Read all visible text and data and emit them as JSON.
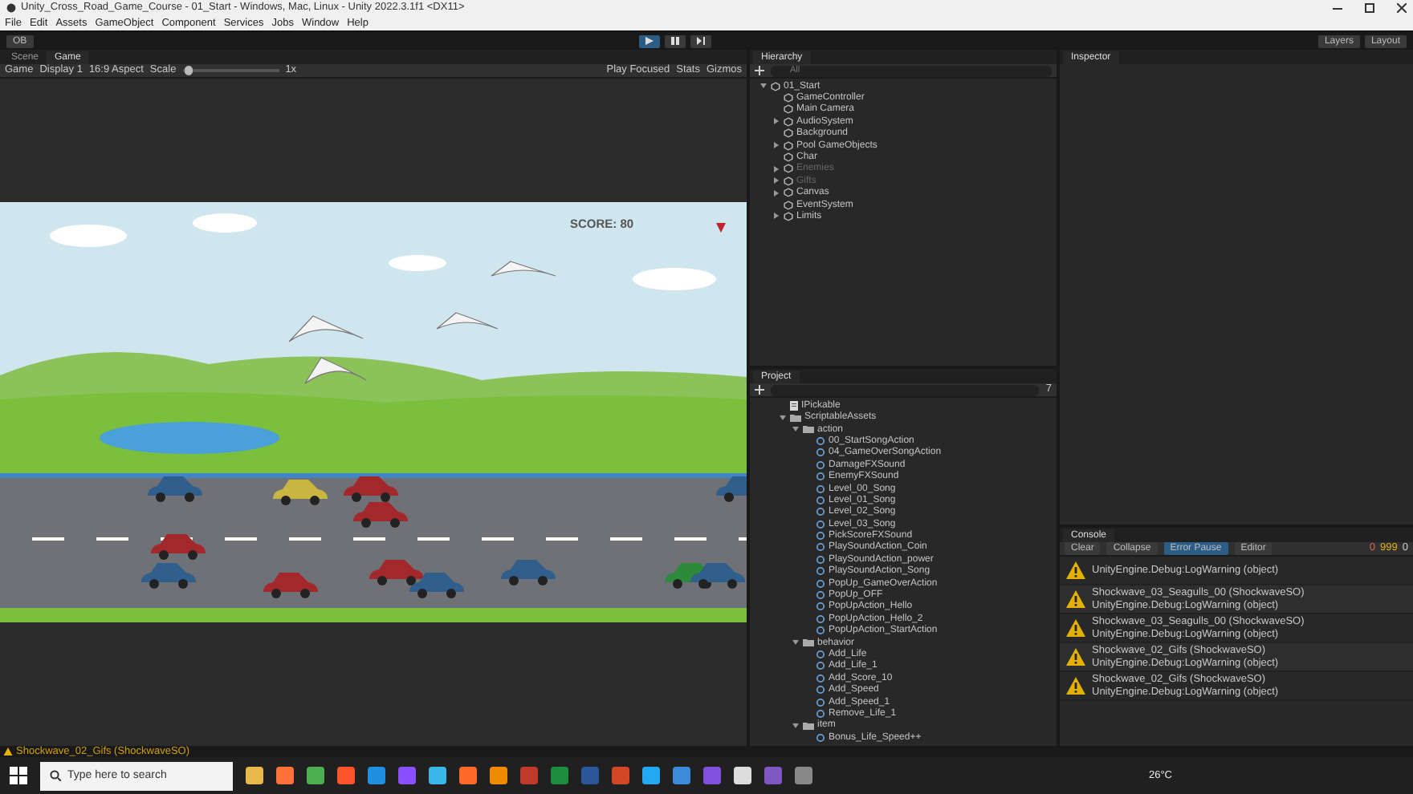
{
  "window": {
    "title": "Unity_Cross_Road_Game_Course - 01_Start - Windows, Mac, Linux - Unity 2022.3.1f1 <DX11>"
  },
  "menu": [
    "File",
    "Edit",
    "Assets",
    "GameObject",
    "Component",
    "Services",
    "Jobs",
    "Window",
    "Help"
  ],
  "toolbar": {
    "account": "OB",
    "playing": true,
    "paused": false,
    "layers": "Layers",
    "layout": "Layout"
  },
  "view_tabs": [
    {
      "label": "Scene",
      "selected": false
    },
    {
      "label": "Game",
      "selected": true
    }
  ],
  "game_toolbar": {
    "mode": "Game",
    "display": "Display 1",
    "aspect": "16:9 Aspect",
    "scale_label": "Scale",
    "scale_slider": {
      "level": 0.02
    },
    "scale_value": "1x",
    "play_mode": "Play Focused",
    "stats": "Stats",
    "gizmos": "Gizmos"
  },
  "game": {
    "score": "SCORE: 80"
  },
  "hierarchy": {
    "title": "Hierarchy",
    "search_placeholder": "All",
    "items": [
      {
        "label": "01_Start",
        "expanded": true,
        "disabled": false,
        "children": [
          {
            "label": "GameController",
            "disabled": false
          },
          {
            "label": "Main Camera",
            "disabled": false
          },
          {
            "label": "AudioSystem",
            "expanded": false,
            "disabled": false
          },
          {
            "label": "Background",
            "disabled": false
          },
          {
            "label": "Pool GameObjects",
            "expanded": false,
            "disabled": false
          },
          {
            "label": "Char",
            "disabled": false
          },
          {
            "label": "Enemies",
            "expanded": false,
            "disabled": true
          },
          {
            "label": "Gifts",
            "expanded": false,
            "disabled": true
          },
          {
            "label": "Canvas",
            "expanded": false,
            "disabled": false
          },
          {
            "label": "EventSystem",
            "disabled": false
          },
          {
            "label": "Limits",
            "expanded": false,
            "disabled": false
          }
        ]
      }
    ]
  },
  "inspector": {
    "title": "Inspector"
  },
  "project": {
    "title": "Project",
    "count": "7",
    "items": [
      {
        "label": "IPickable",
        "kind": "script"
      },
      {
        "label": "ScriptableAssets",
        "kind": "folder",
        "expanded": true,
        "children": [
          {
            "label": "action",
            "kind": "folder",
            "expanded": true,
            "children": [
              {
                "label": "00_StartSongAction",
                "kind": "asset"
              },
              {
                "label": "04_GameOverSongAction",
                "kind": "asset"
              },
              {
                "label": "DamageFXSound",
                "kind": "asset"
              },
              {
                "label": "EnemyFXSound",
                "kind": "asset"
              },
              {
                "label": "Level_00_Song",
                "kind": "asset"
              },
              {
                "label": "Level_01_Song",
                "kind": "asset"
              },
              {
                "label": "Level_02_Song",
                "kind": "asset"
              },
              {
                "label": "Level_03_Song",
                "kind": "asset"
              },
              {
                "label": "PickScoreFXSound",
                "kind": "asset"
              },
              {
                "label": "PlaySoundAction_Coin",
                "kind": "asset"
              },
              {
                "label": "PlaySoundAction_power",
                "kind": "asset"
              },
              {
                "label": "PlaySoundAction_Song",
                "kind": "asset"
              },
              {
                "label": "PopUp_GameOverAction",
                "kind": "asset"
              },
              {
                "label": "PopUp_OFF",
                "kind": "asset"
              },
              {
                "label": "PopUpAction_Hello",
                "kind": "asset"
              },
              {
                "label": "PopUpAction_Hello_2",
                "kind": "asset"
              },
              {
                "label": "PopUpAction_StartAction",
                "kind": "asset"
              }
            ]
          },
          {
            "label": "behavior",
            "kind": "folder",
            "expanded": true,
            "children": [
              {
                "label": "Add_Life",
                "kind": "asset"
              },
              {
                "label": "Add_Life_1",
                "kind": "asset"
              },
              {
                "label": "Add_Score_10",
                "kind": "asset"
              },
              {
                "label": "Add_Speed",
                "kind": "asset"
              },
              {
                "label": "Add_Speed_1",
                "kind": "asset"
              },
              {
                "label": "Remove_Life_1",
                "kind": "asset"
              }
            ]
          },
          {
            "label": "item",
            "kind": "folder",
            "expanded": true,
            "children": [
              {
                "label": "Bonus_Life_Speed++",
                "kind": "asset"
              }
            ]
          }
        ]
      }
    ]
  },
  "console": {
    "title": "Console",
    "buttons": [
      {
        "label": "Clear",
        "selected": false
      },
      {
        "label": "Collapse",
        "selected": false
      },
      {
        "label": "Error Pause",
        "selected": true
      },
      {
        "label": "Editor",
        "selected": false
      }
    ],
    "counts": [
      {
        "kind": "error",
        "value": "0"
      },
      {
        "kind": "warning",
        "value": "999"
      },
      {
        "kind": "info",
        "value": "0"
      }
    ],
    "entries": [
      {
        "kind": "warning",
        "lines": [
          "UnityEngine.Debug:LogWarning (object)"
        ]
      },
      {
        "kind": "warning",
        "lines": [
          "Shockwave_03_Seagulls_00 (ShockwaveSO)",
          "UnityEngine.Debug:LogWarning (object)"
        ]
      },
      {
        "kind": "warning",
        "lines": [
          "Shockwave_03_Seagulls_00 (ShockwaveSO)",
          "UnityEngine.Debug:LogWarning (object)"
        ]
      },
      {
        "kind": "warning",
        "lines": [
          "Shockwave_02_Gifs (ShockwaveSO)",
          "UnityEngine.Debug:LogWarning (object)"
        ]
      },
      {
        "kind": "warning",
        "lines": [
          "Shockwave_02_Gifs (ShockwaveSO)",
          "UnityEngine.Debug:LogWarning (object)"
        ]
      }
    ]
  },
  "status_bar": {
    "message": "Shockwave_02_Gifs (ShockwaveSO)"
  },
  "taskbar": {
    "search_placeholder": "Type here to search",
    "temperature": "26°C"
  }
}
